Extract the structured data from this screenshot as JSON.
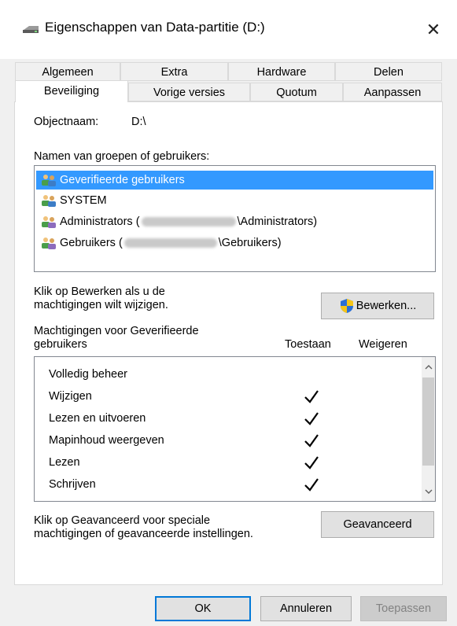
{
  "window": {
    "title": "Eigenschappen van Data-partitie (D:)",
    "close_glyph": "✕"
  },
  "tabs_row1": [
    "Algemeen",
    "Extra",
    "Hardware",
    "Delen"
  ],
  "tabs_row2": [
    "Beveiliging",
    "Vorige versies",
    "Quotum",
    "Aanpassen"
  ],
  "active_tab": "Beveiliging",
  "object": {
    "label": "Objectnaam:",
    "value": "D:\\"
  },
  "groups": {
    "label": "Namen van groepen of gebruikers:",
    "items": [
      {
        "name": "Geverifieerde gebruikers",
        "selected": true
      },
      {
        "name": "SYSTEM"
      },
      {
        "prefix": "Administrators (",
        "suffix": "\\Administrators)"
      },
      {
        "prefix": "Gebruikers (",
        "suffix": "\\Gebruikers)"
      }
    ]
  },
  "edit": {
    "hint_line1": "Klik op Bewerken als u de",
    "hint_line2": "machtigingen wilt wijzigen.",
    "button": "Bewerken..."
  },
  "permissions": {
    "title_line1": "Machtigingen voor Geverifieerde",
    "title_line2": "gebruikers",
    "col_allow": "Toestaan",
    "col_deny": "Weigeren",
    "rows": [
      {
        "name": "Volledig beheer",
        "allow": false
      },
      {
        "name": "Wijzigen",
        "allow": true
      },
      {
        "name": "Lezen en uitvoeren",
        "allow": true
      },
      {
        "name": "Mapinhoud weergeven",
        "allow": true
      },
      {
        "name": "Lezen",
        "allow": true
      },
      {
        "name": "Schrijven",
        "allow": true
      }
    ]
  },
  "advanced": {
    "hint_line1": "Klik op Geavanceerd voor speciale",
    "hint_line2": "machtigingen of geavanceerde instellingen.",
    "button": "Geavanceerd"
  },
  "footer": {
    "ok": "OK",
    "cancel": "Annuleren",
    "apply": "Toepassen"
  },
  "colors": {
    "selection": "#3399ff",
    "focus": "#0078d7"
  }
}
